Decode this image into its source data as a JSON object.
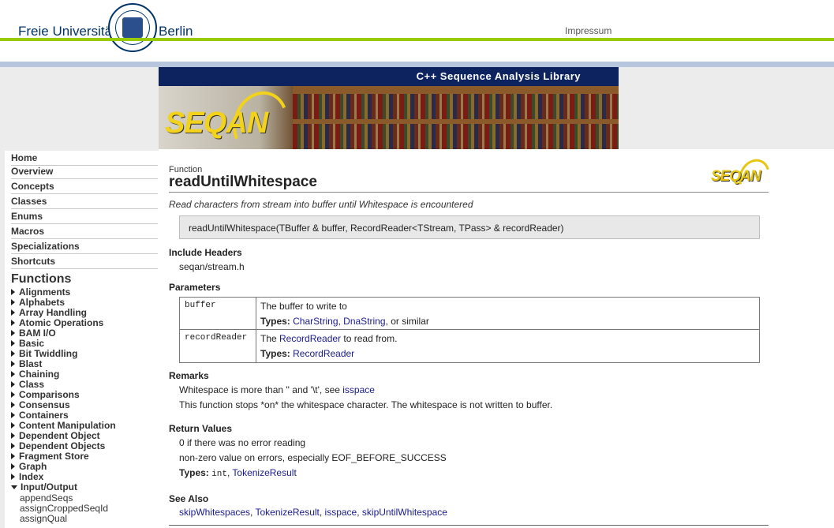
{
  "header": {
    "uni_left": "Freie Universität",
    "uni_right": "Berlin",
    "impressum": "Impressum"
  },
  "banner": {
    "title": "C++ Sequence Analysis Library",
    "logo": "SEQAN"
  },
  "sidebar": {
    "nav": [
      "Home",
      "Overview",
      "Concepts",
      "Classes",
      "Enums",
      "Macros",
      "Specializations",
      "Shortcuts"
    ],
    "functions_heading": "Functions",
    "functions": [
      "Alignments",
      "Alphabets",
      "Array Handling",
      "Atomic Operations",
      "BAM I/O",
      "Basic",
      "Bit Twiddling",
      "Blast",
      "Chaining",
      "Class",
      "Comparisons",
      "Consensus",
      "Containers",
      "Content Manipulation",
      "Dependent Object",
      "Dependent Objects",
      "Fragment Store",
      "Graph",
      "Index",
      "Input/Output"
    ],
    "expanded": [
      "appendSeqs",
      "assignCroppedSeqId",
      "assignQual"
    ]
  },
  "content": {
    "kind": "Function",
    "name": "readUntilWhitespace",
    "logo": "SEQAN",
    "summary": "Read characters from stream into buffer until Whitespace is encountered",
    "signature": "readUntilWhitespace(TBuffer & buffer, RecordReader<TStream, TPass> & recordReader)",
    "include_heading": "Include Headers",
    "include": "seqan/stream.h",
    "params_heading": "Parameters",
    "params": [
      {
        "name": "buffer",
        "desc": "The buffer to write to",
        "types_label": "Types:",
        "type1": "CharString",
        "sep": ", ",
        "type2": "DnaString",
        "suffix": ", or similar"
      },
      {
        "name": "recordReader",
        "desc_pre": "The ",
        "desc_link": "RecordReader",
        "desc_post": " to read from.",
        "types_label": "Types:",
        "type1": "RecordReader"
      }
    ],
    "remarks_heading": "Remarks",
    "remark1_pre": "Whitespace is more than '' and '\\t', see ",
    "remark1_link": "isspace",
    "remark2": "This function stops *on* the whitespace character. The whitespace is not written to buffer.",
    "returns_heading": "Return Values",
    "return1": "0 if there was no error reading",
    "return2": "non-zero value on errors, especially EOF_BEFORE_SUCCESS",
    "return_types_label": "Types:",
    "return_type_mono": "int",
    "return_sep": ", ",
    "return_type_link": "TokenizeResult",
    "seealso_heading": "See Also",
    "seealso": [
      "skipWhitespaces",
      "TokenizeResult",
      "isspace",
      "skipUntilWhitespace"
    ],
    "seealso_sep": ", "
  }
}
